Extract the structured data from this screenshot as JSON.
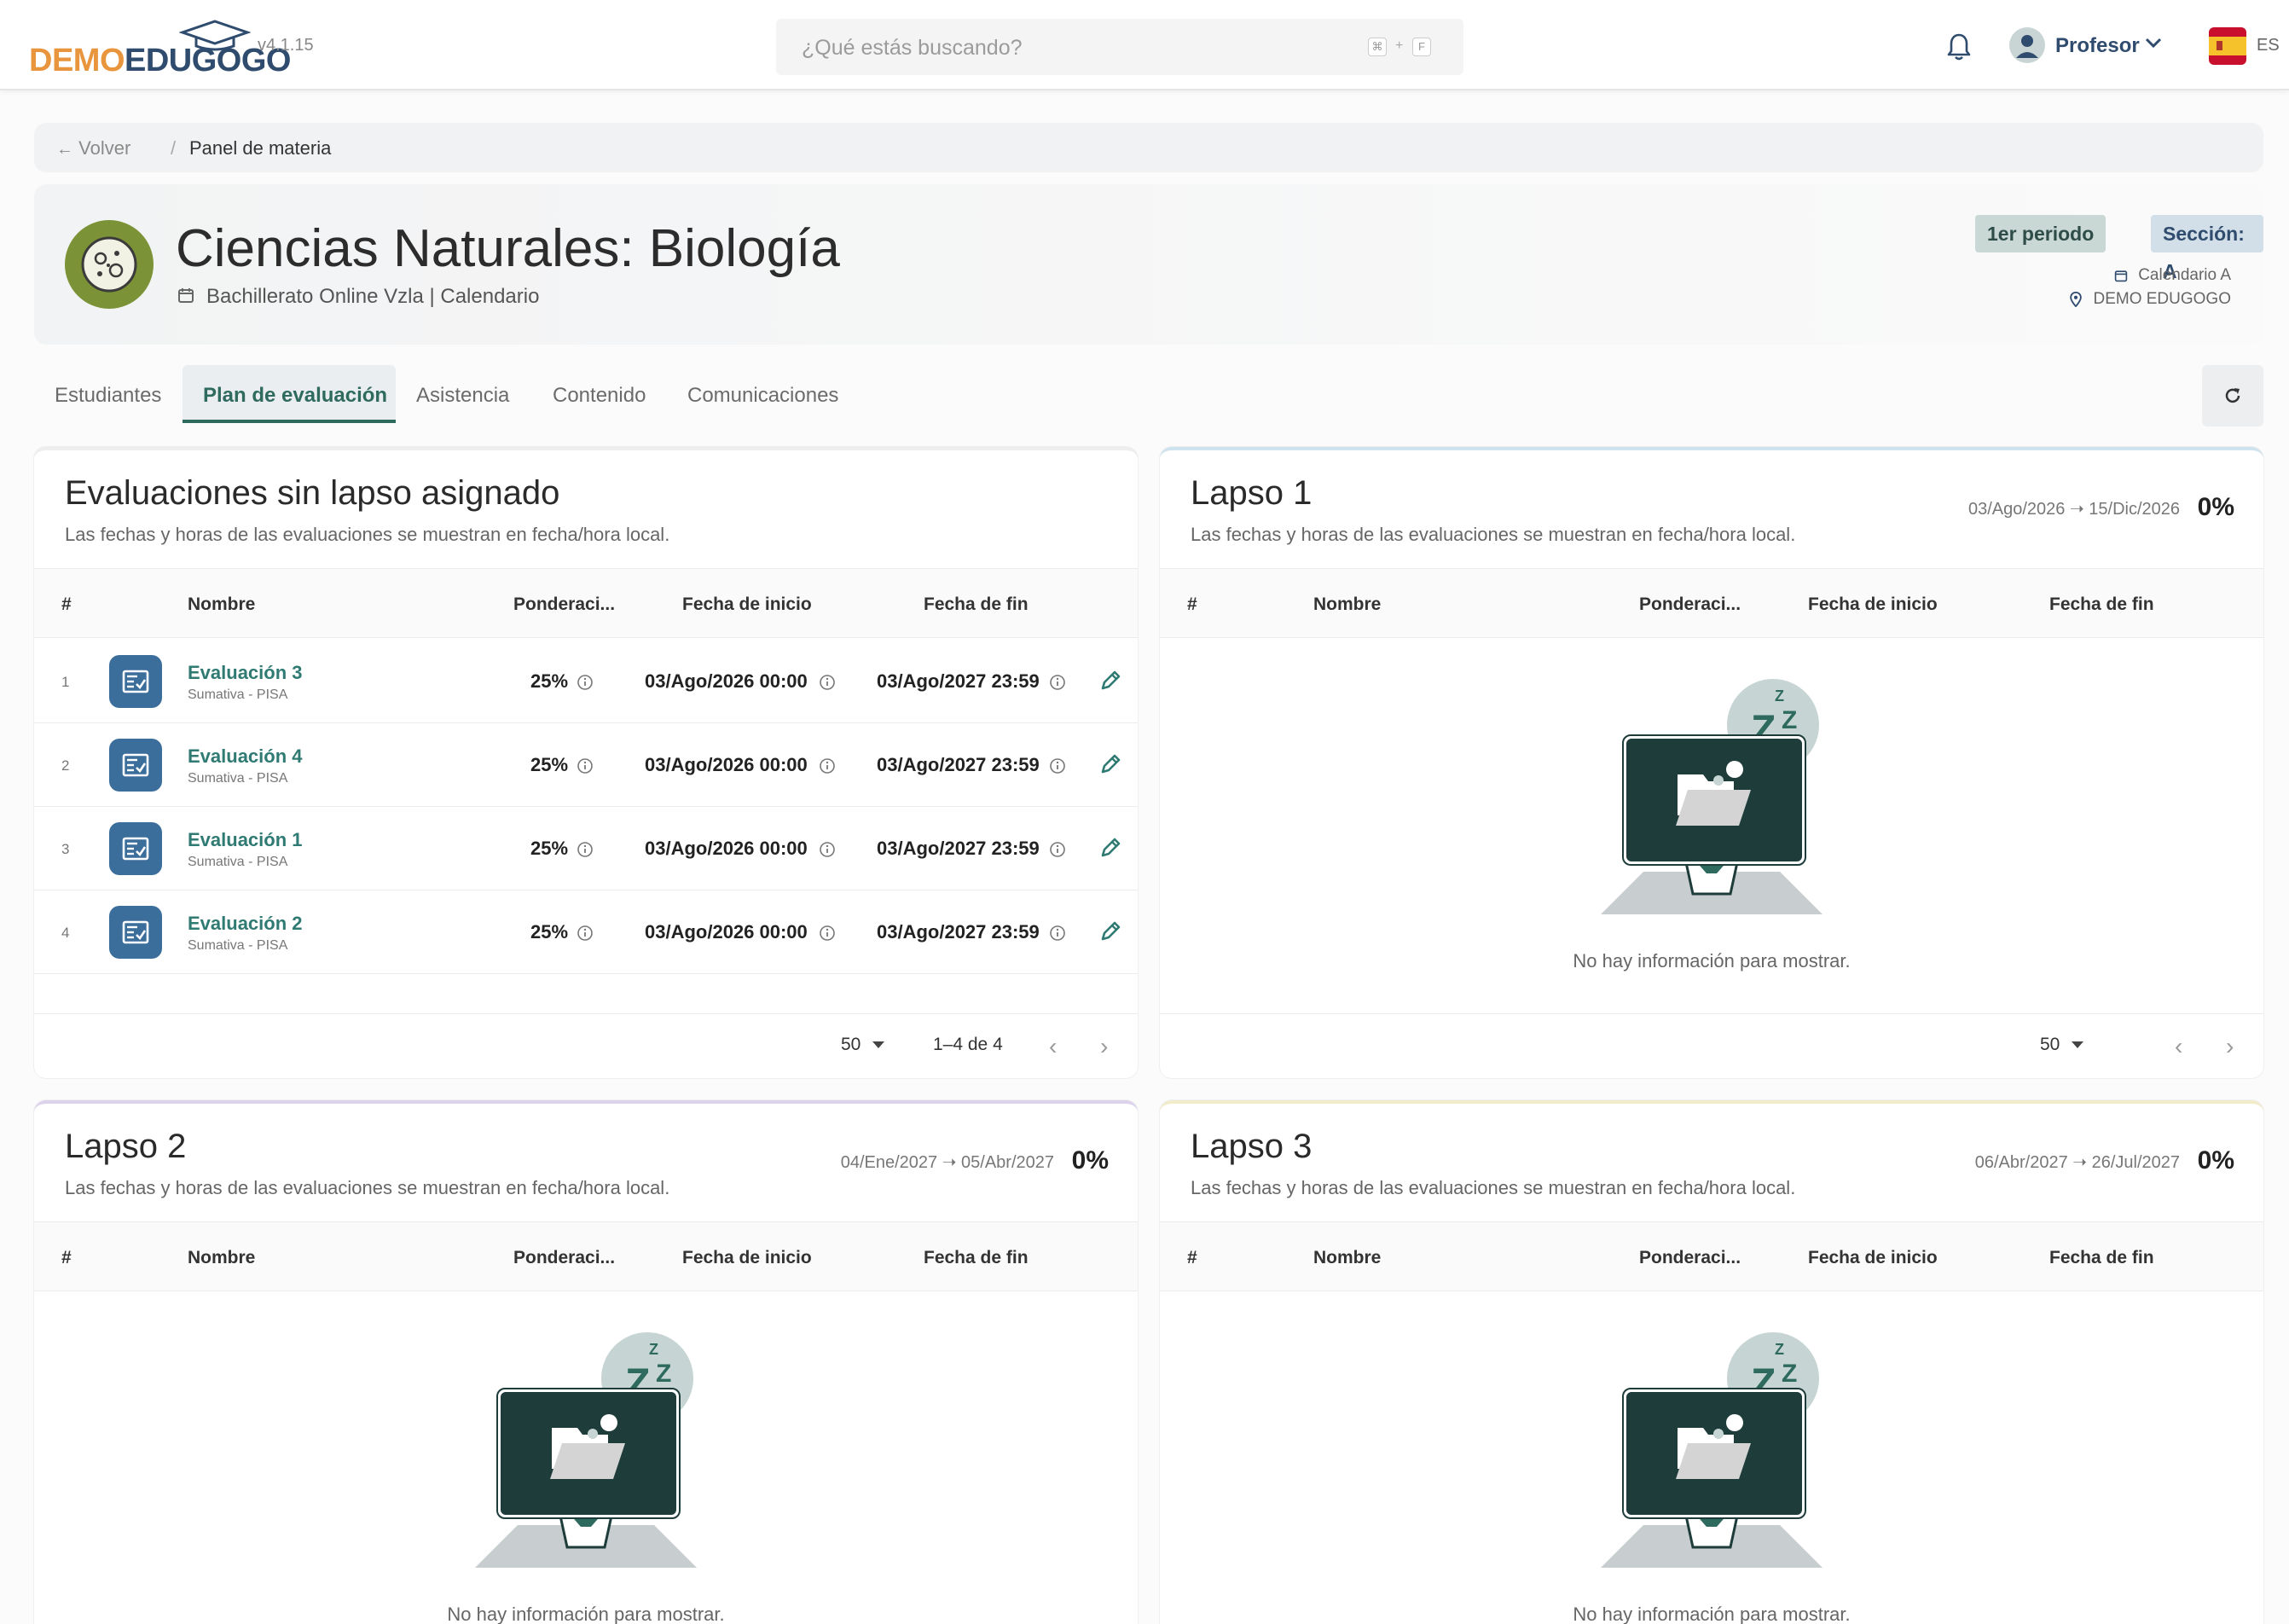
{
  "brand": {
    "part1": "DEMO",
    "part2": "EDUGOGO",
    "version": "v4.1.15"
  },
  "search": {
    "placeholder": "¿Qué estás buscando?",
    "key1": "⌘",
    "plus": "+",
    "key2": "F"
  },
  "user": {
    "name": "Profesor",
    "lang": "ES"
  },
  "breadcrumb": {
    "back": "Volver",
    "separator": "/",
    "current": "Panel de materia"
  },
  "subject": {
    "title": "Ciencias Naturales: Biología",
    "subtitle": "Bachillerato Online Vzla | Calendario",
    "period_badge": "1er periodo",
    "section_badge": "Sección: A",
    "calendar": "Calendario A",
    "location": "DEMO EDUGOGO"
  },
  "tabs": [
    {
      "label": "Estudiantes"
    },
    {
      "label": "Plan de evaluación",
      "active": true
    },
    {
      "label": "Asistencia"
    },
    {
      "label": "Contenido"
    },
    {
      "label": "Comunicaciones"
    }
  ],
  "columns": {
    "idx": "#",
    "name": "Nombre",
    "weight": "Ponderaci...",
    "start": "Fecha de inicio",
    "end": "Fecha de fin"
  },
  "panels": {
    "sin": {
      "title": "Evaluaciones sin lapso asignado",
      "subtitle": "Las fechas y horas de las evaluaciones se muestran en fecha/hora local.",
      "rows": [
        {
          "idx": "1",
          "name": "Evaluación 3",
          "type": "Sumativa - PISA",
          "weight": "25%",
          "start": "03/Ago/2026 00:00",
          "end": "03/Ago/2027 23:59"
        },
        {
          "idx": "2",
          "name": "Evaluación 4",
          "type": "Sumativa - PISA",
          "weight": "25%",
          "start": "03/Ago/2026 00:00",
          "end": "03/Ago/2027 23:59"
        },
        {
          "idx": "3",
          "name": "Evaluación 1",
          "type": "Sumativa - PISA",
          "weight": "25%",
          "start": "03/Ago/2026 00:00",
          "end": "03/Ago/2027 23:59"
        },
        {
          "idx": "4",
          "name": "Evaluación 2",
          "type": "Sumativa - PISA",
          "weight": "25%",
          "start": "03/Ago/2026 00:00",
          "end": "03/Ago/2027 23:59"
        }
      ],
      "page_size": "50",
      "page_range": "1–4 de 4"
    },
    "l1": {
      "title": "Lapso 1",
      "subtitle": "Las fechas y horas de las evaluaciones se muestran en fecha/hora local.",
      "range": "03/Ago/2026 ➝ 15/Dic/2026",
      "percent": "0%",
      "empty": "No hay información para mostrar.",
      "page_size": "50"
    },
    "l2": {
      "title": "Lapso 2",
      "subtitle": "Las fechas y horas de las evaluaciones se muestran en fecha/hora local.",
      "range": "04/Ene/2027 ➝ 05/Abr/2027",
      "percent": "0%",
      "empty": "No hay información para mostrar."
    },
    "l3": {
      "title": "Lapso 3",
      "subtitle": "Las fechas y horas de las evaluaciones se muestran en fecha/hora local.",
      "range": "06/Abr/2027 ➝ 26/Jul/2027",
      "percent": "0%",
      "empty": "No hay información para mostrar."
    }
  },
  "colors": {
    "accent": "#2f6a5f",
    "brand_orange": "#e9953d",
    "brand_blue": "#2f4c6e",
    "eval_icon": "#3c6e9c"
  }
}
